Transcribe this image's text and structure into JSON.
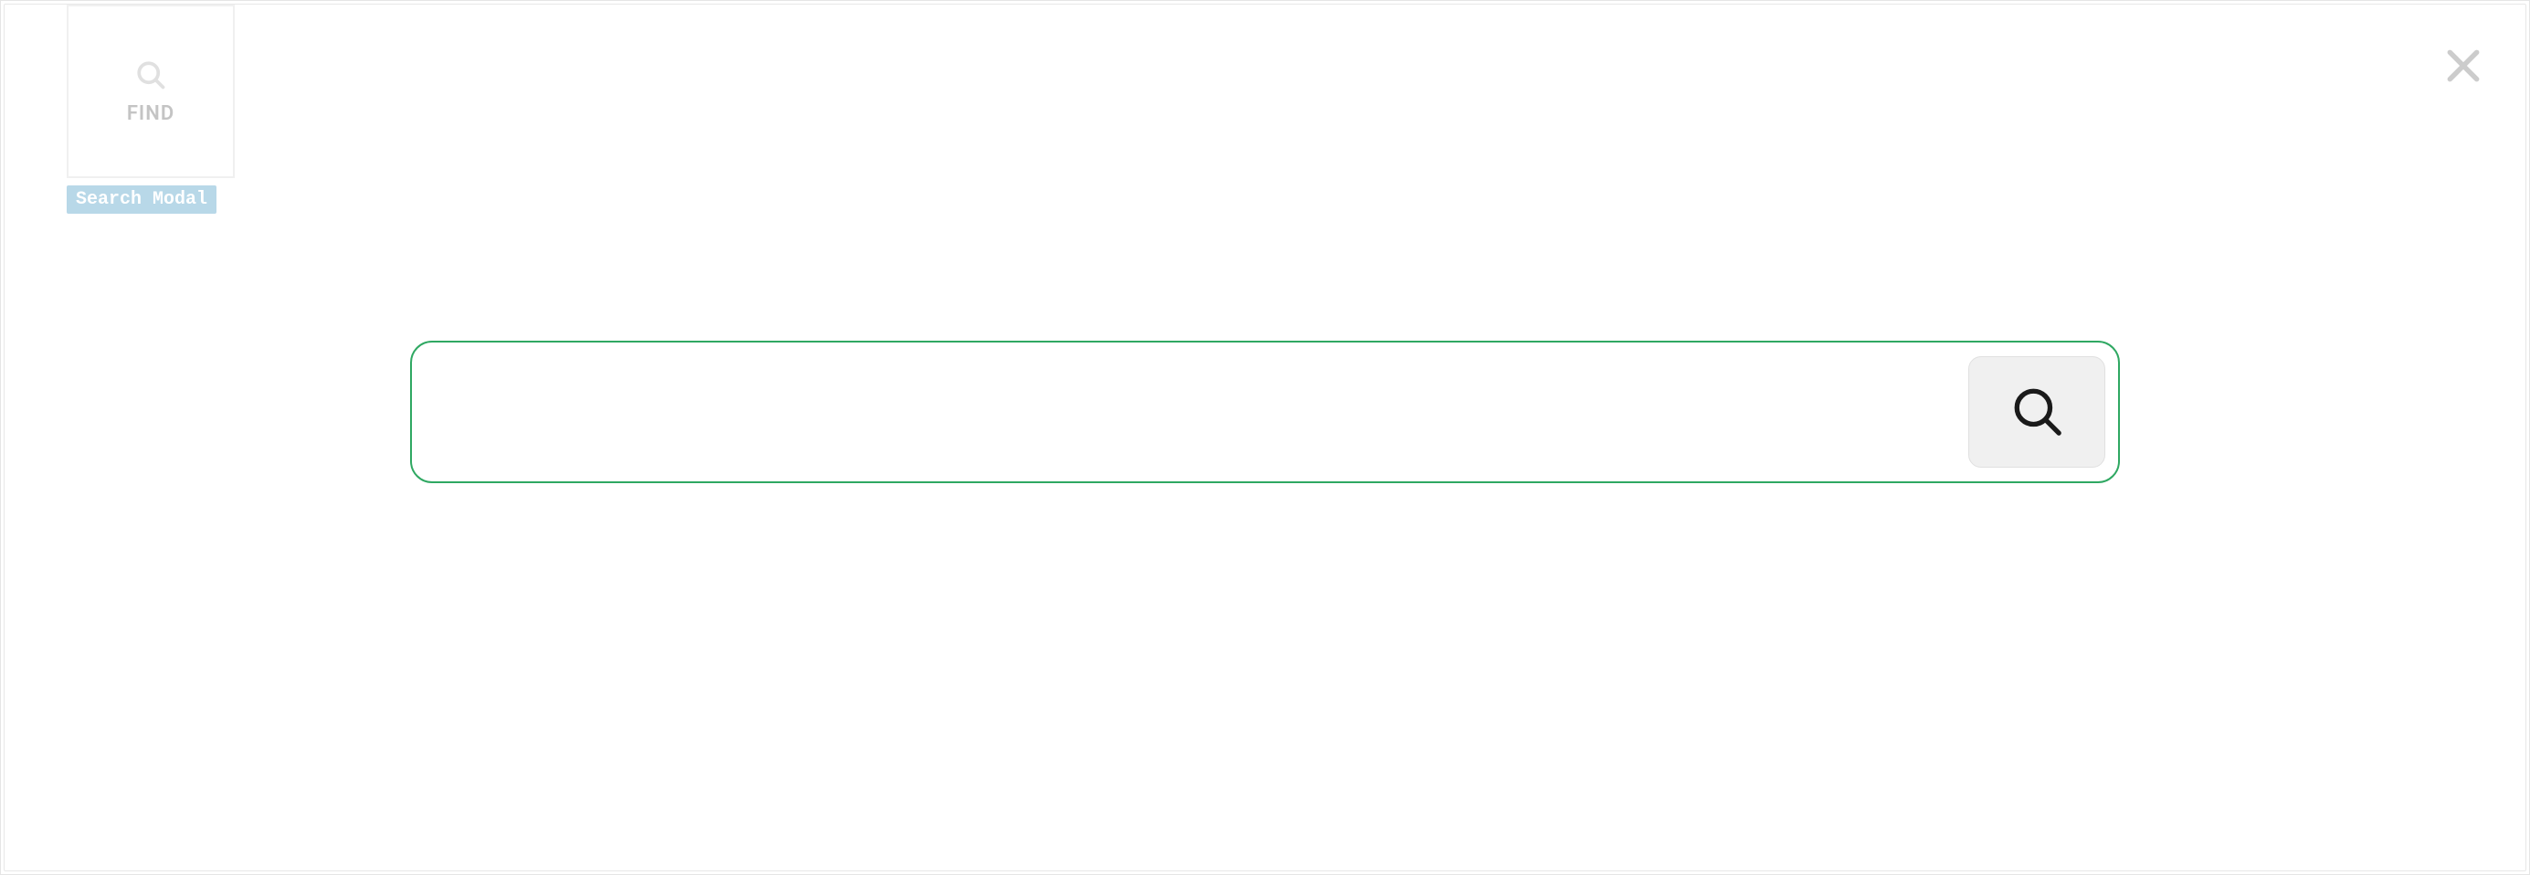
{
  "find_button": {
    "label": "FIND"
  },
  "badge": {
    "label": "Search Modal"
  },
  "search": {
    "value": "",
    "placeholder": ""
  },
  "colors": {
    "accent_green": "#2fa862",
    "badge_bg": "#b8d8e8"
  }
}
